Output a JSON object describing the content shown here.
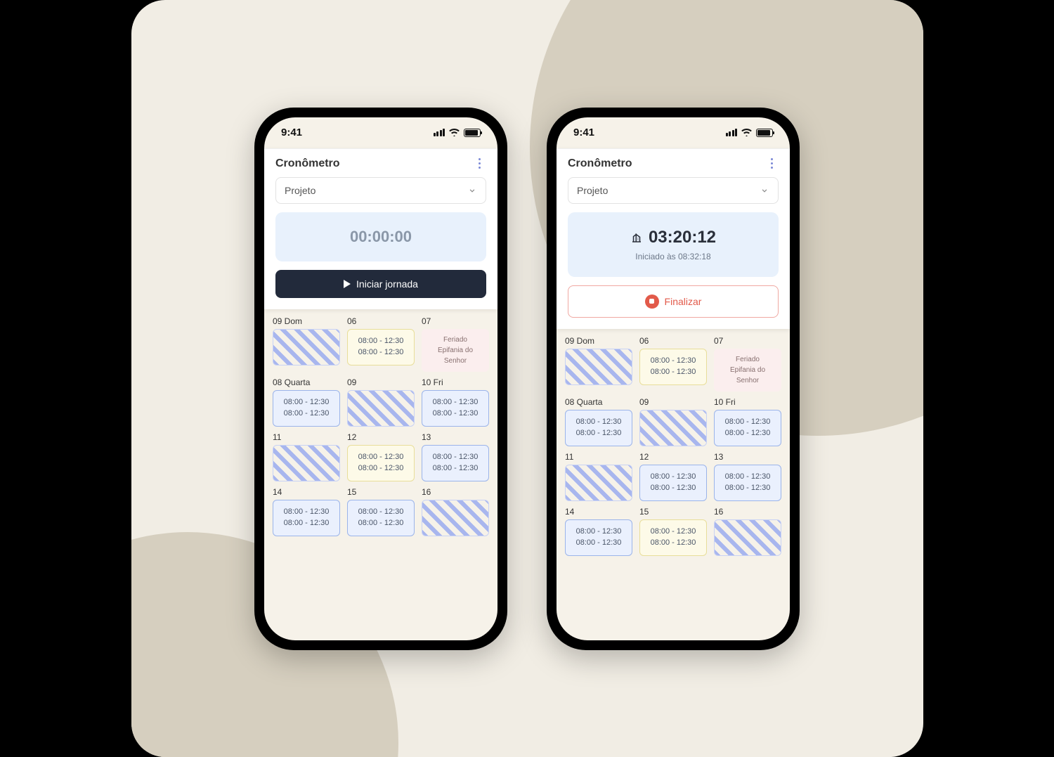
{
  "statusbar": {
    "time": "9:41"
  },
  "header": {
    "title": "Cronômetro"
  },
  "select": {
    "label": "Projeto"
  },
  "left": {
    "timer": "00:00:00",
    "button": "Iniciar jornada"
  },
  "right": {
    "timer": "03:20:12",
    "sub": "Iniciado às 08:32:18",
    "button": "Finalizar"
  },
  "days_left": [
    {
      "label": "09 Dom",
      "type": "striped"
    },
    {
      "label": "06",
      "type": "yellow",
      "l1": "08:00 - 12:30",
      "l2": "08:00 - 12:30"
    },
    {
      "label": "07",
      "type": "pink",
      "l1": "Feriado",
      "l2": "Epifania do Senhor"
    },
    {
      "label": "08 Quarta",
      "type": "blue",
      "l1": "08:00 - 12:30",
      "l2": "08:00 - 12:30"
    },
    {
      "label": "09",
      "type": "striped"
    },
    {
      "label": "10 Fri",
      "type": "blue",
      "l1": "08:00 - 12:30",
      "l2": "08:00 - 12:30"
    },
    {
      "label": "11",
      "type": "striped"
    },
    {
      "label": "12",
      "type": "yellow",
      "l1": "08:00 - 12:30",
      "l2": "08:00 - 12:30"
    },
    {
      "label": "13",
      "type": "blue",
      "l1": "08:00 - 12:30",
      "l2": "08:00 - 12:30"
    },
    {
      "label": "14",
      "type": "blue",
      "l1": "08:00 - 12:30",
      "l2": "08:00 - 12:30"
    },
    {
      "label": "15",
      "type": "blue",
      "l1": "08:00 - 12:30",
      "l2": "08:00 - 12:30"
    },
    {
      "label": "16",
      "type": "striped"
    }
  ],
  "days_right": [
    {
      "label": "09 Dom",
      "type": "striped"
    },
    {
      "label": "06",
      "type": "yellow",
      "l1": "08:00 - 12:30",
      "l2": "08:00 - 12:30"
    },
    {
      "label": "07",
      "type": "pink",
      "l1": "Feriado",
      "l2": "Epifania do Senhor"
    },
    {
      "label": "08 Quarta",
      "type": "blue",
      "l1": "08:00 - 12:30",
      "l2": "08:00 - 12:30"
    },
    {
      "label": "09",
      "type": "striped"
    },
    {
      "label": "10 Fri",
      "type": "blue",
      "l1": "08:00 - 12:30",
      "l2": "08:00 - 12:30"
    },
    {
      "label": "11",
      "type": "striped"
    },
    {
      "label": "12",
      "type": "blue",
      "l1": "08:00 - 12:30",
      "l2": "08:00 - 12:30"
    },
    {
      "label": "13",
      "type": "blue",
      "l1": "08:00 - 12:30",
      "l2": "08:00 - 12:30"
    },
    {
      "label": "14",
      "type": "blue",
      "l1": "08:00 - 12:30",
      "l2": "08:00 - 12:30"
    },
    {
      "label": "15",
      "type": "yellow",
      "l1": "08:00 - 12:30",
      "l2": "08:00 - 12:30"
    },
    {
      "label": "16",
      "type": "striped"
    }
  ]
}
